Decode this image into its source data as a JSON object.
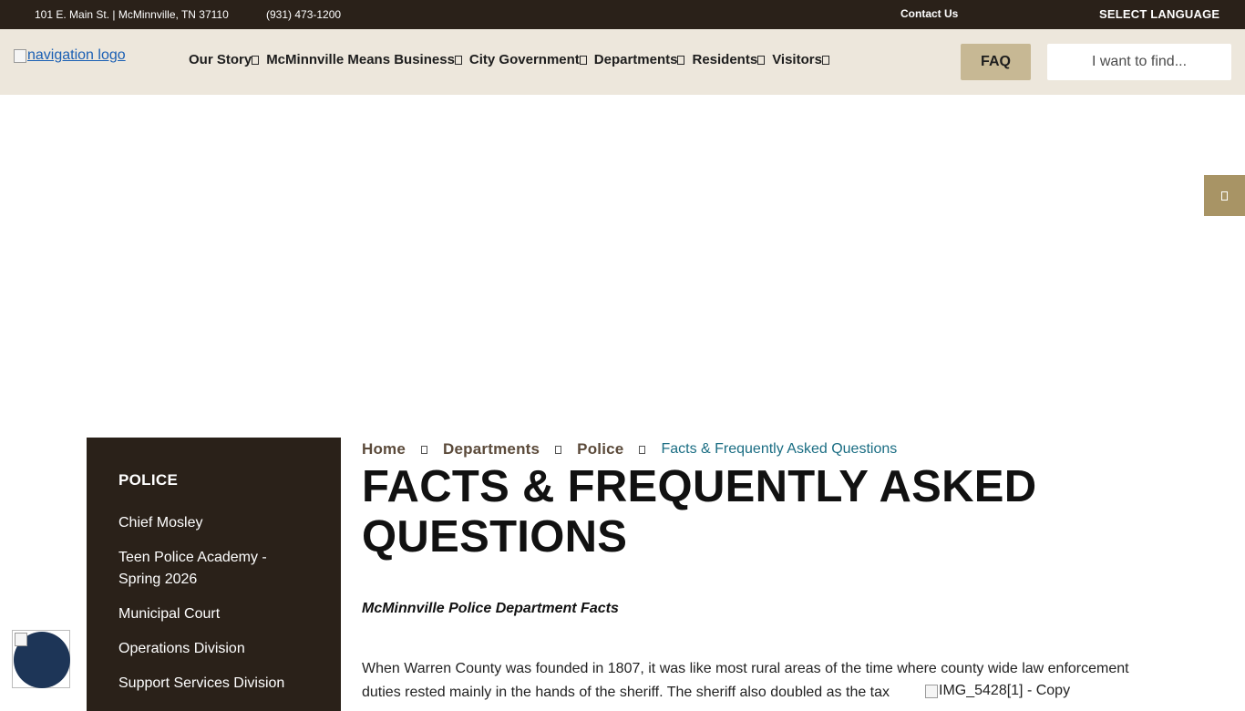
{
  "topbar": {
    "address": "101 E. Main St. | McMinnville, TN 37110",
    "phone": "(931) 473-1200",
    "contact_label": "Contact Us",
    "language_label": "SELECT LANGUAGE"
  },
  "header": {
    "logo_alt": "navigation logo",
    "nav_items": [
      {
        "label": "Our Story"
      },
      {
        "label": "McMinnville Means Business"
      },
      {
        "label": "City Government"
      },
      {
        "label": "Departments"
      },
      {
        "label": "Residents"
      },
      {
        "label": "Visitors"
      }
    ],
    "faq_label": "FAQ",
    "search_placeholder": "I want to find..."
  },
  "sidebar": {
    "heading": "POLICE",
    "items": [
      {
        "label": "Chief Mosley"
      },
      {
        "label": "Teen Police Academy - Spring 2026"
      },
      {
        "label": "Municipal Court"
      },
      {
        "label": "Operations Division"
      },
      {
        "label": "Support Services Division"
      }
    ]
  },
  "breadcrumb": {
    "items": [
      "Home",
      "Departments",
      "Police"
    ],
    "current": "Facts & Frequently Asked Questions"
  },
  "main": {
    "title": "FACTS & FREQUENTLY ASKED QUESTIONS",
    "subheading": "McMinnville Police Department Facts",
    "paragraph_line1": "When Warren County was founded in 1807, it was like most rural areas of the time where county wide law enforcement",
    "paragraph_line2": "duties rested mainly in the hands of the sheriff. The sheriff also doubled as the tax",
    "image_alt": "IMG_5428[1] - Copy"
  },
  "colors": {
    "topbar_bg": "#2a2119",
    "nav_bg": "#ede7dc",
    "faq_bg": "#c7b894",
    "side_tab_bg": "#a89465",
    "breadcrumb_current": "#1a6d83",
    "a11y_bg": "#1d3557"
  }
}
